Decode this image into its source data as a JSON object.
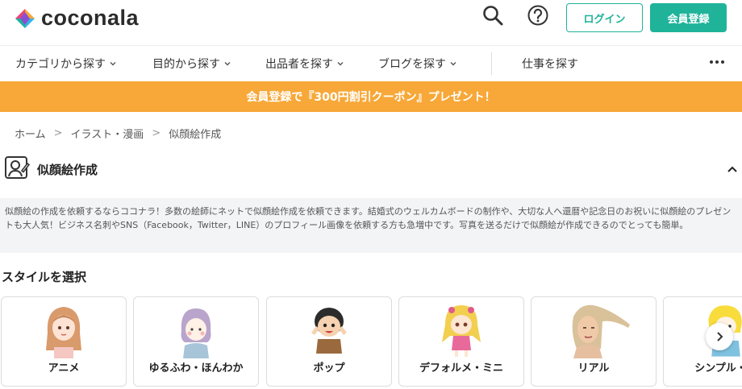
{
  "header": {
    "logo_text": "coconala",
    "login_label": "ログイン",
    "register_label": "会員登録"
  },
  "nav": {
    "items": [
      {
        "label": "カテゴリから探す"
      },
      {
        "label": "目的から探す"
      },
      {
        "label": "出品者を探す"
      },
      {
        "label": "ブログを探す"
      }
    ],
    "jobs_label": "仕事を探す"
  },
  "banner": {
    "text": "会員登録で『300円割引クーポン』プレゼント！"
  },
  "breadcrumb": {
    "items": [
      "ホーム",
      "イラスト・漫画",
      "似顔絵作成"
    ],
    "separator": ">"
  },
  "category": {
    "title": "似顔絵作成",
    "description": "似顔絵の作成を依頼するならココナラ！多数の絵師にネットで似顔絵作成を依頼できます。結婚式のウェルカムボードの制作や、大切な人へ還暦や記念日のお祝いに似顔絵のプレゼントも大人気！ビジネス名刺やSNS（Facebook，Twitter，LINE）のプロフィール画像を依頼する方も急増中です。写真を送るだけで似顔絵が作成できるのでとっても簡単。"
  },
  "styles": {
    "section_title": "スタイルを選択",
    "items": [
      {
        "label": "アニメ"
      },
      {
        "label": "ゆるふわ・ほんわか"
      },
      {
        "label": "ポップ"
      },
      {
        "label": "デフォルメ・ミニ"
      },
      {
        "label": "リアル"
      },
      {
        "label": "シンプル・フ"
      }
    ]
  },
  "colors": {
    "brand_green": "#1fb39a",
    "banner_orange": "#f7a838"
  },
  "icons": [
    "search-icon",
    "help-icon",
    "chevron-down-icon",
    "more-icon",
    "portrait-icon",
    "chevron-up-icon",
    "chevron-right-icon"
  ]
}
